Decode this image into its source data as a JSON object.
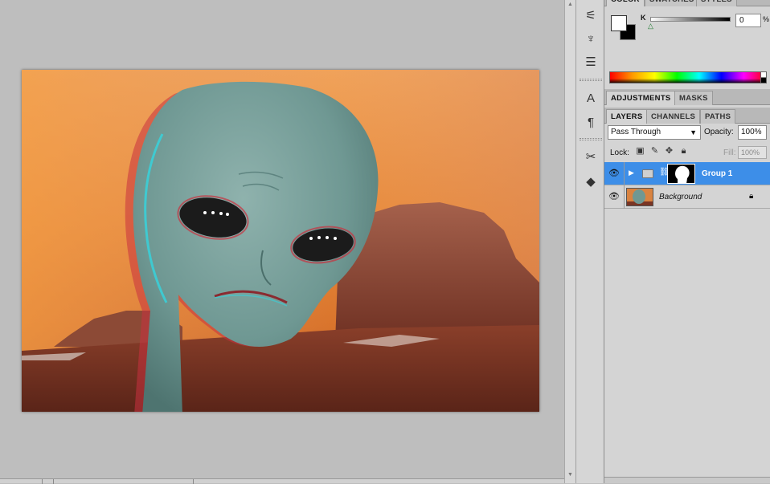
{
  "color_panel": {
    "tabs": [
      {
        "label": "COLOR",
        "active": true
      },
      {
        "label": "SWATCHES",
        "active": false
      },
      {
        "label": "STYLES",
        "active": false
      }
    ],
    "channel_label": "K",
    "channel_value": "0",
    "percent_sign": "%",
    "foreground": "#ffffff",
    "background": "#000000"
  },
  "adjustments_panel": {
    "tabs": [
      {
        "label": "ADJUSTMENTS",
        "active": true
      },
      {
        "label": "MASKS",
        "active": false
      }
    ]
  },
  "layers_panel": {
    "tabs": [
      {
        "label": "LAYERS",
        "active": true
      },
      {
        "label": "CHANNELS",
        "active": false
      },
      {
        "label": "PATHS",
        "active": false
      }
    ],
    "blend_mode": "Pass Through",
    "opacity_label": "Opacity:",
    "opacity_value": "100%",
    "lock_label": "Lock:",
    "fill_label": "Fill:",
    "fill_value": "100%",
    "layers": [
      {
        "name": "Group 1",
        "type": "group",
        "selected": true,
        "visible": true
      },
      {
        "name": "Background",
        "type": "background",
        "selected": false,
        "visible": true,
        "locked": true
      }
    ]
  },
  "tool_strip": {
    "icons": [
      "brush-presets-icon",
      "clone-source-icon",
      "tool-presets-icon",
      "character-icon",
      "paragraph-icon",
      "tools-icon",
      "3d-icon"
    ]
  },
  "accent_color": "#3d8ee8"
}
